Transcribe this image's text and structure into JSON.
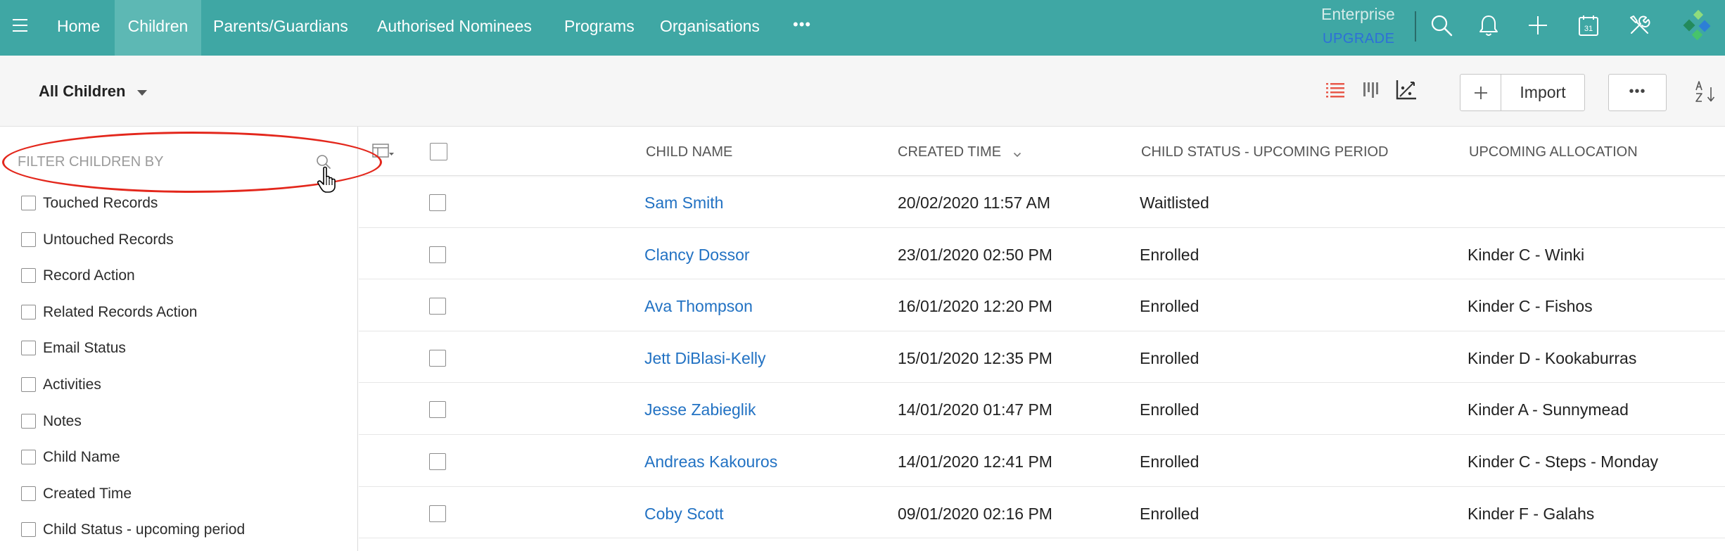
{
  "nav": {
    "menu_icon": "hamburger-menu-icon",
    "tabs": [
      {
        "label": "Home",
        "active": false
      },
      {
        "label": "Children",
        "active": true
      },
      {
        "label": "Parents/Guardians",
        "active": false
      },
      {
        "label": "Authorised Nominees",
        "active": false
      },
      {
        "label": "Programs",
        "active": false
      },
      {
        "label": "Organisations",
        "active": false
      }
    ],
    "more_label": "•••",
    "edition": "Enterprise",
    "upgrade_label": "UPGRADE",
    "utility_icons": [
      "search-icon",
      "bell-icon",
      "plus-icon",
      "calendar-icon",
      "tools-icon"
    ],
    "calendar_day": "31",
    "logo_icon": "app-logo"
  },
  "toolbar": {
    "view_selector": "All Children",
    "view_selector_icon": "caret-down-icon",
    "view_icons": [
      "list-view-icon",
      "kanban-view-icon",
      "chart-view-icon"
    ],
    "active_view": "list-view-icon",
    "add_icon": "plus-icon",
    "import_label": "Import",
    "more_label": "•••",
    "sort_icon": "sort-alpha-icon"
  },
  "filter": {
    "placeholder": "FILTER CHILDREN BY",
    "search_icon": "search-icon",
    "items": [
      "Touched Records",
      "Untouched Records",
      "Record Action",
      "Related Records Action",
      "Email Status",
      "Activities",
      "Notes",
      "Child Name",
      "Created Time",
      "Child Status - upcoming period"
    ]
  },
  "table": {
    "column_settings_icon": "column-settings-icon",
    "columns": [
      "CHILD NAME",
      "CREATED TIME",
      "CHILD STATUS - UPCOMING PERIOD",
      "UPCOMING ALLOCATION"
    ],
    "sort_indicator": {
      "column": "CREATED TIME",
      "icon": "chevron-down-icon"
    },
    "rows": [
      {
        "name": "Sam Smith",
        "created": "20/02/2020 11:57 AM",
        "status": "Waitlisted"
      },
      {
        "name": "Clancy Dossor",
        "created": "23/01/2020 02:50 PM",
        "status": "Enrolled",
        "allocation": "Kinder C - Winki"
      },
      {
        "name": "Ava Thompson",
        "created": "16/01/2020 12:20 PM",
        "status": "Enrolled",
        "allocation": "Kinder C - Fishos"
      },
      {
        "name": "Jett DiBlasi-Kelly",
        "created": "15/01/2020 12:35 PM",
        "status": "Enrolled",
        "allocation": "Kinder D - Kookaburras"
      },
      {
        "name": "Jesse Zabieglik",
        "created": "14/01/2020 01:47 PM",
        "status": "Enrolled",
        "allocation": "Kinder A - Sunnymead"
      },
      {
        "name": "Andreas Kakouros",
        "created": "14/01/2020 12:41 PM",
        "status": "Enrolled",
        "allocation": "Kinder C - Steps - Monday"
      },
      {
        "name": "Coby Scott",
        "created": "09/01/2020 02:16 PM",
        "status": "Enrolled",
        "allocation": "Kinder F - Galahs"
      }
    ]
  },
  "overlay": {
    "cursor_icon": "hand-pointer-icon"
  },
  "colors": {
    "nav_bar": "#3fa7a4",
    "nav_active_tab": "#5db8b4",
    "upgrade_link": "#2d6fd8",
    "child_name_link": "#2272c3",
    "active_view_icon": "#e8594b",
    "annotation_ellipse": "#e3271c"
  }
}
